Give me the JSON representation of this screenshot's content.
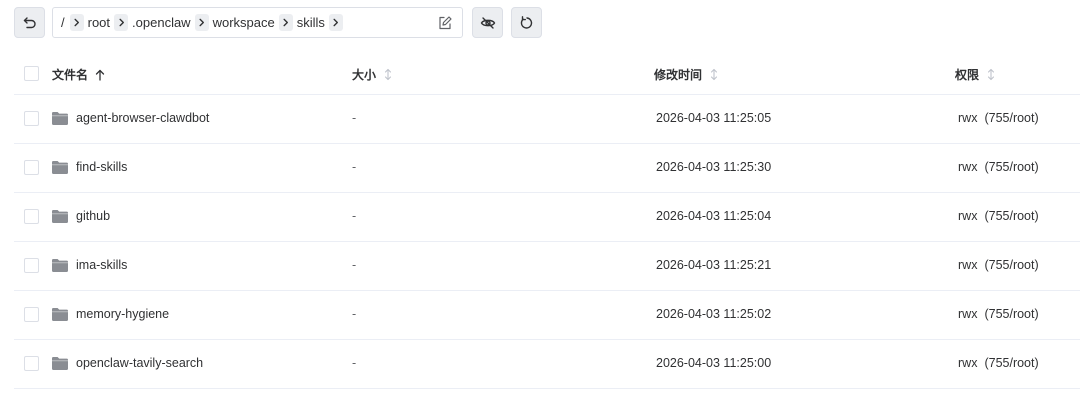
{
  "toolbar": {
    "back_icon": "undo-arrow-icon",
    "path": {
      "root_label": "/",
      "segments": [
        "root",
        ".openclaw",
        "workspace",
        "skills"
      ]
    },
    "edit_icon": "edit-icon",
    "hide_icon": "eye-off-icon",
    "refresh_icon": "refresh-icon"
  },
  "table": {
    "columns": {
      "name": "文件名",
      "size": "大小",
      "modified": "修改时间",
      "permission": "权限"
    },
    "sort": {
      "name": "ascending"
    },
    "rows": [
      {
        "name": "agent-browser-clawdbot",
        "size": "-",
        "modified": "2026-04-03 11:25:05",
        "perm": "rwx",
        "owner": "(755/root)"
      },
      {
        "name": "find-skills",
        "size": "-",
        "modified": "2026-04-03 11:25:30",
        "perm": "rwx",
        "owner": "(755/root)"
      },
      {
        "name": "github",
        "size": "-",
        "modified": "2026-04-03 11:25:04",
        "perm": "rwx",
        "owner": "(755/root)"
      },
      {
        "name": "ima-skills",
        "size": "-",
        "modified": "2026-04-03 11:25:21",
        "perm": "rwx",
        "owner": "(755/root)"
      },
      {
        "name": "memory-hygiene",
        "size": "-",
        "modified": "2026-04-03 11:25:02",
        "perm": "rwx",
        "owner": "(755/root)"
      },
      {
        "name": "openclaw-tavily-search",
        "size": "-",
        "modified": "2026-04-03 11:25:00",
        "perm": "rwx",
        "owner": "(755/root)"
      }
    ]
  },
  "colors": {
    "button_bg": "#eceef1",
    "border": "#dcdfe6",
    "row_divider": "#ebeef5",
    "folder": "#8a8d93",
    "text": "#303133"
  }
}
